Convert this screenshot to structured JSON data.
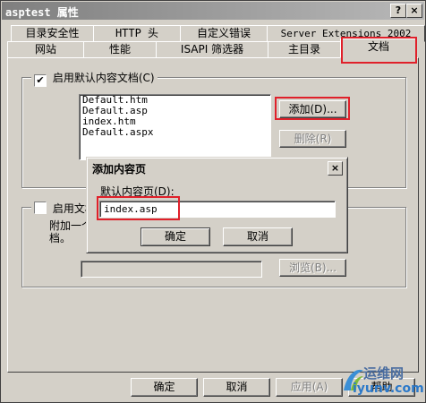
{
  "window": {
    "title": "asptest 属性",
    "help_btn": "?",
    "close_btn": "×"
  },
  "tabs_row1": [
    "目录安全性",
    "HTTP 头",
    "自定义错误",
    "Server Extensions 2002"
  ],
  "tabs_row2": [
    "网站",
    "性能",
    "ISAPI 筛选器",
    "主目录",
    "文档"
  ],
  "panel": {
    "enable_default_label": "启用默认内容文档(C)",
    "enable_default_checked": "✔",
    "documents": [
      "Default.htm",
      "Default.asp",
      "index.htm",
      "Default.aspx"
    ],
    "add_button": "添加(D)...",
    "remove_button": "删除(R)",
    "enable_footer_label": "启用文档",
    "footer_desc_line1": "附加一个",
    "footer_desc_line2": "档。",
    "browse_button": "浏览(B)..."
  },
  "dialog": {
    "title": "添加内容页",
    "close": "×",
    "field_label": "默认内容页(D):",
    "field_value": "index.asp",
    "ok": "确定",
    "cancel": "取消"
  },
  "footer": {
    "ok": "确定",
    "cancel": "取消",
    "apply": "应用(A)",
    "help": "帮助"
  },
  "watermark": {
    "line1": "运维网",
    "line2": "iyunv.com"
  },
  "colors": {
    "highlight": "#e0202a",
    "title_gradient_start": "#7f7f7f"
  }
}
